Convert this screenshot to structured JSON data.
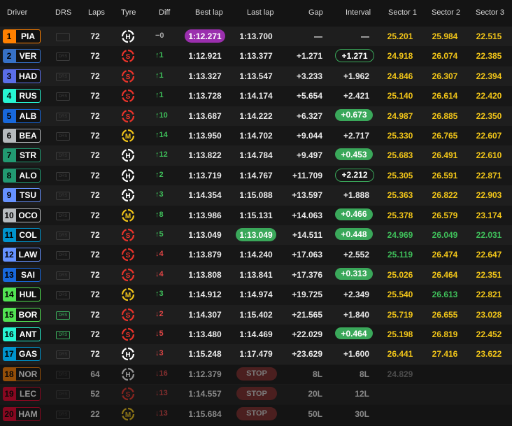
{
  "headers": {
    "driver": "Driver",
    "drs": "DRS",
    "laps": "Laps",
    "tyre": "Tyre",
    "diff": "Diff",
    "best": "Best lap",
    "last": "Last lap",
    "gap": "Gap",
    "interval": "Interval",
    "s1": "Sector 1",
    "s2": "Sector 2",
    "s3": "Sector 3"
  },
  "colors": {
    "purple": "#9b2fae",
    "green": "#3fbf5a",
    "yellow": "#f0c419",
    "red": "#e04545"
  },
  "rows": [
    {
      "pos": "1",
      "abbr": "PIA",
      "team": "#ff8000",
      "drs": "",
      "drs_on": false,
      "laps": "72",
      "tyre": "H",
      "tyre_icon": "hard-tyre-icon",
      "diff": "−0",
      "diff_dir": "same",
      "best": "1:12.271",
      "best_style": "purple",
      "last": "1:13.700",
      "last_style": "",
      "gap": "—",
      "interval": "—",
      "int_style": "",
      "s1": "25.201",
      "s1c": "yellow",
      "s2": "25.984",
      "s2c": "yellow",
      "s3": "22.515",
      "s3c": "yellow",
      "dim": false
    },
    {
      "pos": "2",
      "abbr": "VER",
      "team": "#3671c6",
      "drs": "DRS",
      "drs_on": false,
      "laps": "72",
      "tyre": "S",
      "tyre_icon": "soft-tyre-icon",
      "diff": "↑1",
      "diff_dir": "up",
      "best": "1:12.921",
      "best_style": "",
      "last": "1:13.377",
      "last_style": "",
      "gap": "+1.271",
      "interval": "+1.271",
      "int_style": "outline",
      "s1": "24.918",
      "s1c": "yellow",
      "s2": "26.074",
      "s2c": "yellow",
      "s3": "22.385",
      "s3c": "yellow",
      "dim": false
    },
    {
      "pos": "3",
      "abbr": "HAD",
      "team": "#5a6ee8",
      "drs": "DRS",
      "drs_on": false,
      "laps": "72",
      "tyre": "S",
      "tyre_icon": "soft-tyre-icon",
      "diff": "↑1",
      "diff_dir": "up",
      "best": "1:13.327",
      "best_style": "",
      "last": "1:13.547",
      "last_style": "",
      "gap": "+3.233",
      "interval": "+1.962",
      "int_style": "",
      "s1": "24.846",
      "s1c": "yellow",
      "s2": "26.307",
      "s2c": "yellow",
      "s3": "22.394",
      "s3c": "yellow",
      "dim": false
    },
    {
      "pos": "4",
      "abbr": "RUS",
      "team": "#27f4d2",
      "drs": "DRS",
      "drs_on": false,
      "laps": "72",
      "tyre": "S",
      "tyre_icon": "soft-tyre-icon",
      "diff": "↑1",
      "diff_dir": "up",
      "best": "1:13.728",
      "best_style": "",
      "last": "1:14.174",
      "last_style": "",
      "gap": "+5.654",
      "interval": "+2.421",
      "int_style": "",
      "s1": "25.140",
      "s1c": "yellow",
      "s2": "26.614",
      "s2c": "yellow",
      "s3": "22.420",
      "s3c": "yellow",
      "dim": false
    },
    {
      "pos": "5",
      "abbr": "ALB",
      "team": "#1868db",
      "drs": "DRS",
      "drs_on": false,
      "laps": "72",
      "tyre": "S",
      "tyre_icon": "soft-tyre-icon",
      "diff": "↑10",
      "diff_dir": "up",
      "best": "1:13.687",
      "best_style": "",
      "last": "1:14.222",
      "last_style": "",
      "gap": "+6.327",
      "interval": "+0.673",
      "int_style": "fill",
      "s1": "24.987",
      "s1c": "yellow",
      "s2": "26.885",
      "s2c": "yellow",
      "s3": "22.350",
      "s3c": "yellow",
      "dim": false
    },
    {
      "pos": "6",
      "abbr": "BEA",
      "team": "#b6babd",
      "drs": "DRS",
      "drs_on": false,
      "laps": "72",
      "tyre": "M",
      "tyre_icon": "medium-tyre-icon",
      "diff": "↑14",
      "diff_dir": "up",
      "best": "1:13.950",
      "best_style": "",
      "last": "1:14.702",
      "last_style": "",
      "gap": "+9.044",
      "interval": "+2.717",
      "int_style": "",
      "s1": "25.330",
      "s1c": "yellow",
      "s2": "26.765",
      "s2c": "yellow",
      "s3": "22.607",
      "s3c": "yellow",
      "dim": false
    },
    {
      "pos": "7",
      "abbr": "STR",
      "team": "#229971",
      "drs": "DRS",
      "drs_on": false,
      "laps": "72",
      "tyre": "H",
      "tyre_icon": "hard-tyre-icon",
      "diff": "↑12",
      "diff_dir": "up",
      "best": "1:13.822",
      "best_style": "",
      "last": "1:14.784",
      "last_style": "",
      "gap": "+9.497",
      "interval": "+0.453",
      "int_style": "fill",
      "s1": "25.683",
      "s1c": "yellow",
      "s2": "26.491",
      "s2c": "yellow",
      "s3": "22.610",
      "s3c": "yellow",
      "dim": false
    },
    {
      "pos": "8",
      "abbr": "ALO",
      "team": "#229971",
      "drs": "DRS",
      "drs_on": false,
      "laps": "72",
      "tyre": "H",
      "tyre_icon": "hard-tyre-icon",
      "diff": "↑2",
      "diff_dir": "up",
      "best": "1:13.719",
      "best_style": "",
      "last": "1:14.767",
      "last_style": "",
      "gap": "+11.709",
      "interval": "+2.212",
      "int_style": "outline",
      "s1": "25.305",
      "s1c": "yellow",
      "s2": "26.591",
      "s2c": "yellow",
      "s3": "22.871",
      "s3c": "yellow",
      "dim": false
    },
    {
      "pos": "9",
      "abbr": "TSU",
      "team": "#6692ff",
      "drs": "DRS",
      "drs_on": false,
      "laps": "72",
      "tyre": "H",
      "tyre_icon": "hard-tyre-icon",
      "diff": "↑3",
      "diff_dir": "up",
      "best": "1:14.354",
      "best_style": "",
      "last": "1:15.088",
      "last_style": "",
      "gap": "+13.597",
      "interval": "+1.888",
      "int_style": "",
      "s1": "25.363",
      "s1c": "yellow",
      "s2": "26.822",
      "s2c": "yellow",
      "s3": "22.903",
      "s3c": "yellow",
      "dim": false
    },
    {
      "pos": "10",
      "abbr": "OCO",
      "team": "#b6babd",
      "drs": "DRS",
      "drs_on": false,
      "laps": "72",
      "tyre": "M",
      "tyre_icon": "medium-tyre-icon",
      "diff": "↑8",
      "diff_dir": "up",
      "best": "1:13.986",
      "best_style": "",
      "last": "1:15.131",
      "last_style": "",
      "gap": "+14.063",
      "interval": "+0.466",
      "int_style": "fill",
      "s1": "25.378",
      "s1c": "yellow",
      "s2": "26.579",
      "s2c": "yellow",
      "s3": "23.174",
      "s3c": "yellow",
      "dim": false
    },
    {
      "pos": "11",
      "abbr": "COL",
      "team": "#0093cc",
      "drs": "DRS",
      "drs_on": false,
      "laps": "72",
      "tyre": "S",
      "tyre_icon": "soft-tyre-icon",
      "diff": "↑5",
      "diff_dir": "up",
      "best": "1:13.049",
      "best_style": "",
      "last": "1:13.049",
      "last_style": "green",
      "gap": "+14.511",
      "interval": "+0.448",
      "int_style": "fill",
      "s1": "24.969",
      "s1c": "green",
      "s2": "26.049",
      "s2c": "green",
      "s3": "22.031",
      "s3c": "green",
      "dim": false
    },
    {
      "pos": "12",
      "abbr": "LAW",
      "team": "#6692ff",
      "drs": "DRS",
      "drs_on": false,
      "laps": "72",
      "tyre": "S",
      "tyre_icon": "soft-tyre-icon",
      "diff": "↓4",
      "diff_dir": "down",
      "best": "1:13.879",
      "best_style": "",
      "last": "1:14.240",
      "last_style": "",
      "gap": "+17.063",
      "interval": "+2.552",
      "int_style": "",
      "s1": "25.119",
      "s1c": "green",
      "s2": "26.474",
      "s2c": "yellow",
      "s3": "22.647",
      "s3c": "yellow",
      "dim": false
    },
    {
      "pos": "13",
      "abbr": "SAI",
      "team": "#1868db",
      "drs": "DRS",
      "drs_on": false,
      "laps": "72",
      "tyre": "S",
      "tyre_icon": "soft-tyre-icon",
      "diff": "↓4",
      "diff_dir": "down",
      "best": "1:13.808",
      "best_style": "",
      "last": "1:13.841",
      "last_style": "",
      "gap": "+17.376",
      "interval": "+0.313",
      "int_style": "fill",
      "s1": "25.026",
      "s1c": "yellow",
      "s2": "26.464",
      "s2c": "yellow",
      "s3": "22.351",
      "s3c": "yellow",
      "dim": false
    },
    {
      "pos": "14",
      "abbr": "HUL",
      "team": "#52e252",
      "drs": "DRS",
      "drs_on": false,
      "laps": "72",
      "tyre": "M",
      "tyre_icon": "medium-tyre-icon",
      "diff": "↑3",
      "diff_dir": "up",
      "best": "1:14.912",
      "best_style": "",
      "last": "1:14.974",
      "last_style": "",
      "gap": "+19.725",
      "interval": "+2.349",
      "int_style": "",
      "s1": "25.540",
      "s1c": "yellow",
      "s2": "26.613",
      "s2c": "green",
      "s3": "22.821",
      "s3c": "yellow",
      "dim": false
    },
    {
      "pos": "15",
      "abbr": "BOR",
      "team": "#52e252",
      "drs": "DRS",
      "drs_on": true,
      "laps": "72",
      "tyre": "S",
      "tyre_icon": "soft-tyre-icon",
      "diff": "↓2",
      "diff_dir": "down",
      "best": "1:14.307",
      "best_style": "",
      "last": "1:15.402",
      "last_style": "",
      "gap": "+21.565",
      "interval": "+1.840",
      "int_style": "",
      "s1": "25.719",
      "s1c": "yellow",
      "s2": "26.655",
      "s2c": "yellow",
      "s3": "23.028",
      "s3c": "yellow",
      "dim": false
    },
    {
      "pos": "16",
      "abbr": "ANT",
      "team": "#27f4d2",
      "drs": "DRS",
      "drs_on": true,
      "laps": "72",
      "tyre": "S",
      "tyre_icon": "soft-tyre-icon",
      "diff": "↓5",
      "diff_dir": "down",
      "best": "1:13.480",
      "best_style": "",
      "last": "1:14.469",
      "last_style": "",
      "gap": "+22.029",
      "interval": "+0.464",
      "int_style": "fill",
      "s1": "25.198",
      "s1c": "yellow",
      "s2": "26.819",
      "s2c": "yellow",
      "s3": "22.452",
      "s3c": "yellow",
      "dim": false
    },
    {
      "pos": "17",
      "abbr": "GAS",
      "team": "#0093cc",
      "drs": "DRS",
      "drs_on": false,
      "laps": "72",
      "tyre": "H",
      "tyre_icon": "hard-tyre-icon",
      "diff": "↓3",
      "diff_dir": "down",
      "best": "1:15.248",
      "best_style": "",
      "last": "1:17.479",
      "last_style": "",
      "gap": "+23.629",
      "interval": "+1.600",
      "int_style": "",
      "s1": "26.441",
      "s1c": "yellow",
      "s2": "27.416",
      "s2c": "yellow",
      "s3": "23.622",
      "s3c": "yellow",
      "dim": false
    },
    {
      "pos": "18",
      "abbr": "NOR",
      "team": "#ff8000",
      "drs": "DRS",
      "drs_on": false,
      "laps": "64",
      "tyre": "H",
      "tyre_icon": "hard-tyre-icon",
      "diff": "↓16",
      "diff_dir": "down",
      "best": "1:12.379",
      "best_style": "",
      "last": "STOP",
      "last_style": "stop",
      "gap": "8L",
      "interval": "8L",
      "int_style": "",
      "s1": "24.829",
      "s1c": "yellow",
      "s2": "",
      "s2c": "yellow",
      "s3": "",
      "s3c": "yellow",
      "dim": true
    },
    {
      "pos": "19",
      "abbr": "LEC",
      "team": "#e8002d",
      "drs": "DRS",
      "drs_on": false,
      "laps": "52",
      "tyre": "S",
      "tyre_icon": "soft-tyre-icon",
      "diff": "↓13",
      "diff_dir": "down",
      "best": "1:14.557",
      "best_style": "",
      "last": "STOP",
      "last_style": "stop",
      "gap": "20L",
      "interval": "12L",
      "int_style": "",
      "s1": "",
      "s1c": "yellow",
      "s2": "",
      "s2c": "yellow",
      "s3": "",
      "s3c": "yellow",
      "dim": true
    },
    {
      "pos": "20",
      "abbr": "HAM",
      "team": "#e8002d",
      "drs": "DRS",
      "drs_on": false,
      "laps": "22",
      "tyre": "M",
      "tyre_icon": "medium-tyre-icon",
      "diff": "↓13",
      "diff_dir": "down",
      "best": "1:15.684",
      "best_style": "",
      "last": "STOP",
      "last_style": "stop",
      "gap": "50L",
      "interval": "30L",
      "int_style": "",
      "s1": "",
      "s1c": "yellow",
      "s2": "",
      "s2c": "yellow",
      "s3": "",
      "s3c": "yellow",
      "dim": true
    }
  ]
}
